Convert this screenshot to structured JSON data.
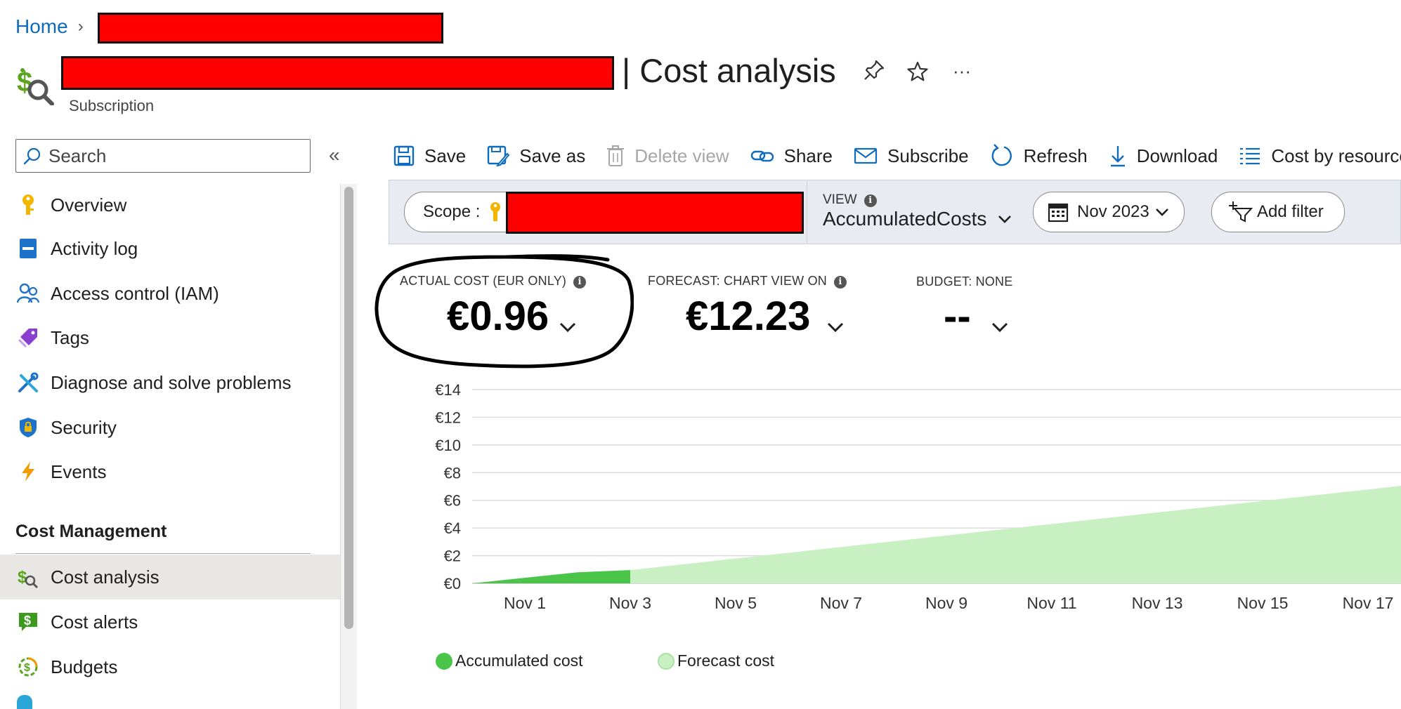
{
  "breadcrumb": {
    "home": "Home"
  },
  "header": {
    "title": "| Cost analysis",
    "subtitle": "Subscription",
    "more_label": "···"
  },
  "search": {
    "placeholder": "Search"
  },
  "sidebar": {
    "items": [
      {
        "label": "Overview",
        "icon": "key-icon"
      },
      {
        "label": "Activity log",
        "icon": "book-icon"
      },
      {
        "label": "Access control (IAM)",
        "icon": "people-icon"
      },
      {
        "label": "Tags",
        "icon": "tag-icon"
      },
      {
        "label": "Diagnose and solve problems",
        "icon": "tools-icon"
      },
      {
        "label": "Security",
        "icon": "shield-icon"
      },
      {
        "label": "Events",
        "icon": "lightning-icon"
      }
    ],
    "section_title": "Cost Management",
    "section_items": [
      {
        "label": "Cost analysis",
        "icon": "cost-analysis-icon",
        "active": true
      },
      {
        "label": "Cost alerts",
        "icon": "cost-alert-icon"
      },
      {
        "label": "Budgets",
        "icon": "budget-icon"
      }
    ]
  },
  "toolbar": {
    "save": "Save",
    "save_as": "Save as",
    "delete_view": "Delete view",
    "share": "Share",
    "subscribe": "Subscribe",
    "refresh": "Refresh",
    "download": "Download",
    "cost_by_resource": "Cost by resource"
  },
  "filters": {
    "scope_label": "Scope :",
    "view_label": "VIEW",
    "view_value": "AccumulatedCosts",
    "date_value": "Nov 2023",
    "add_filter": "Add filter"
  },
  "kpis": {
    "actual_label": "ACTUAL COST (EUR ONLY)",
    "actual_value": "€0.96",
    "forecast_label": "FORECAST: CHART VIEW ON",
    "forecast_value": "€12.23",
    "budget_label": "BUDGET: NONE",
    "budget_value": "--"
  },
  "colors": {
    "accent": "#0f6cbd",
    "accumulated": "#4ac54a",
    "forecast": "#c8f0c3",
    "redaction": "#ff0000"
  },
  "chart_data": {
    "type": "area",
    "x_ticks": [
      "Nov 1",
      "Nov 3",
      "Nov 5",
      "Nov 7",
      "Nov 9",
      "Nov 11",
      "Nov 13",
      "Nov 15",
      "Nov 17"
    ],
    "y_ticks": [
      "€0",
      "€2",
      "€4",
      "€6",
      "€8",
      "€10",
      "€12",
      "€14"
    ],
    "ylim": [
      0,
      14
    ],
    "xlim": [
      "Nov 1",
      "Nov 18"
    ],
    "grid": true,
    "legend_position": "bottom-left",
    "series": [
      {
        "name": "Accumulated cost",
        "points": [
          [
            "Nov 0",
            0
          ],
          [
            "Nov 2",
            0.8
          ],
          [
            "Nov 3",
            0.96
          ]
        ]
      },
      {
        "name": "Forecast cost",
        "points": [
          [
            "Nov 3",
            0.96
          ],
          [
            "Nov 18",
            7.2
          ]
        ]
      }
    ]
  }
}
